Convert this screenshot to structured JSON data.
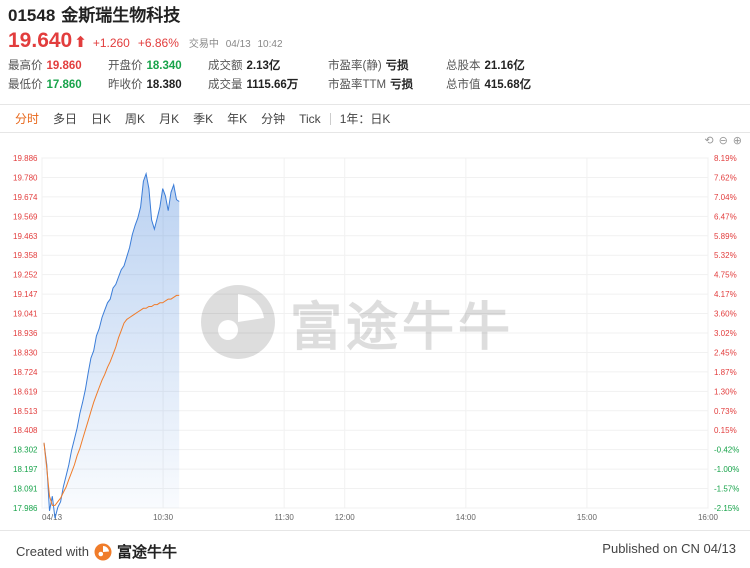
{
  "header": {
    "code": "01548",
    "name": "金斯瑞生物科技",
    "price": "19.640",
    "arrow": "⬆",
    "change": "+1.260",
    "change_pct": "+6.86%",
    "status": "交易中",
    "date": "04/13",
    "time": "10:42"
  },
  "stats": {
    "high_label": "最高价",
    "high_value": "19.860",
    "open_label": "开盘价",
    "open_value": "18.340",
    "turnover_label": "成交额",
    "turnover_value": "2.13亿",
    "pe_static_label": "市盈率(静)",
    "pe_static_value": "亏损",
    "shares_label": "总股本",
    "shares_value": "21.16亿",
    "low_label": "最低价",
    "low_value": "17.860",
    "prev_close_label": "昨收价",
    "prev_close_value": "18.380",
    "volume_label": "成交量",
    "volume_value": "1115.66万",
    "pe_ttm_label": "市盈率TTM",
    "pe_ttm_value": "亏损",
    "mcap_label": "总市值",
    "mcap_value": "415.68亿"
  },
  "tabs": [
    "分时",
    "多日",
    "日K",
    "周K",
    "月K",
    "季K",
    "年K",
    "分钟",
    "Tick"
  ],
  "tab_period": "1年：日K",
  "watermark": "富途牛牛",
  "footer": {
    "created_with": "Created with",
    "brand": "富途牛牛",
    "published": "Published on CN 04/13"
  },
  "colors": {
    "up": "#e23d3d",
    "down": "#17a34a",
    "price_line": "#3b7dd8",
    "avg_line": "#f07c2a",
    "active_tab": "#e8671a"
  },
  "chart_data": {
    "type": "line",
    "y_ticks": [
      "19.886",
      "19.780",
      "19.674",
      "19.569",
      "19.463",
      "19.358",
      "19.252",
      "19.147",
      "19.041",
      "18.936",
      "18.830",
      "18.724",
      "18.619",
      "18.513",
      "18.408",
      "18.302",
      "18.197",
      "18.091",
      "17.986"
    ],
    "pct_ticks": [
      "8.19%",
      "7.62%",
      "7.04%",
      "6.47%",
      "5.89%",
      "5.32%",
      "4.75%",
      "4.17%",
      "3.60%",
      "3.02%",
      "2.45%",
      "1.87%",
      "1.30%",
      "0.73%",
      "0.15%",
      "-0.42%",
      "-1.00%",
      "-1.57%",
      "-2.15%"
    ],
    "x_ticks": [
      "04/13",
      "10:30",
      "11:30",
      "12:00",
      "14:00",
      "15:00",
      "16:00"
    ],
    "prev_close": 18.38,
    "ylim": [
      17.986,
      19.886
    ],
    "series": [
      {
        "values": [
          18.34,
          18.22,
          17.97,
          18.05,
          17.93,
          17.99,
          18.02,
          18.1,
          18.16,
          18.22,
          18.3,
          18.36,
          18.42,
          18.5,
          18.56,
          18.63,
          18.72,
          18.8,
          18.84,
          18.92,
          18.96,
          19.02,
          19.06,
          19.1,
          19.12,
          19.18,
          19.2,
          19.24,
          19.28,
          19.3,
          19.35,
          19.4,
          19.47,
          19.52,
          19.56,
          19.62,
          19.76,
          19.8,
          19.72,
          19.55,
          19.5,
          19.56,
          19.62,
          19.72,
          19.68,
          19.6,
          19.7,
          19.74,
          19.66,
          19.65
        ]
      },
      {
        "values": [
          18.34,
          18.2,
          18.05,
          18.0,
          18.0,
          18.02,
          18.04,
          18.07,
          18.1,
          18.14,
          18.18,
          18.22,
          18.27,
          18.31,
          18.36,
          18.41,
          18.46,
          18.51,
          18.56,
          18.6,
          18.64,
          18.68,
          18.71,
          18.75,
          18.78,
          18.82,
          18.86,
          18.91,
          18.95,
          18.99,
          19.01,
          19.02,
          19.03,
          19.04,
          19.05,
          19.06,
          19.07,
          19.07,
          19.08,
          19.08,
          19.09,
          19.09,
          19.1,
          19.1,
          19.11,
          19.12,
          19.12,
          19.13,
          19.14,
          19.14
        ]
      }
    ]
  }
}
